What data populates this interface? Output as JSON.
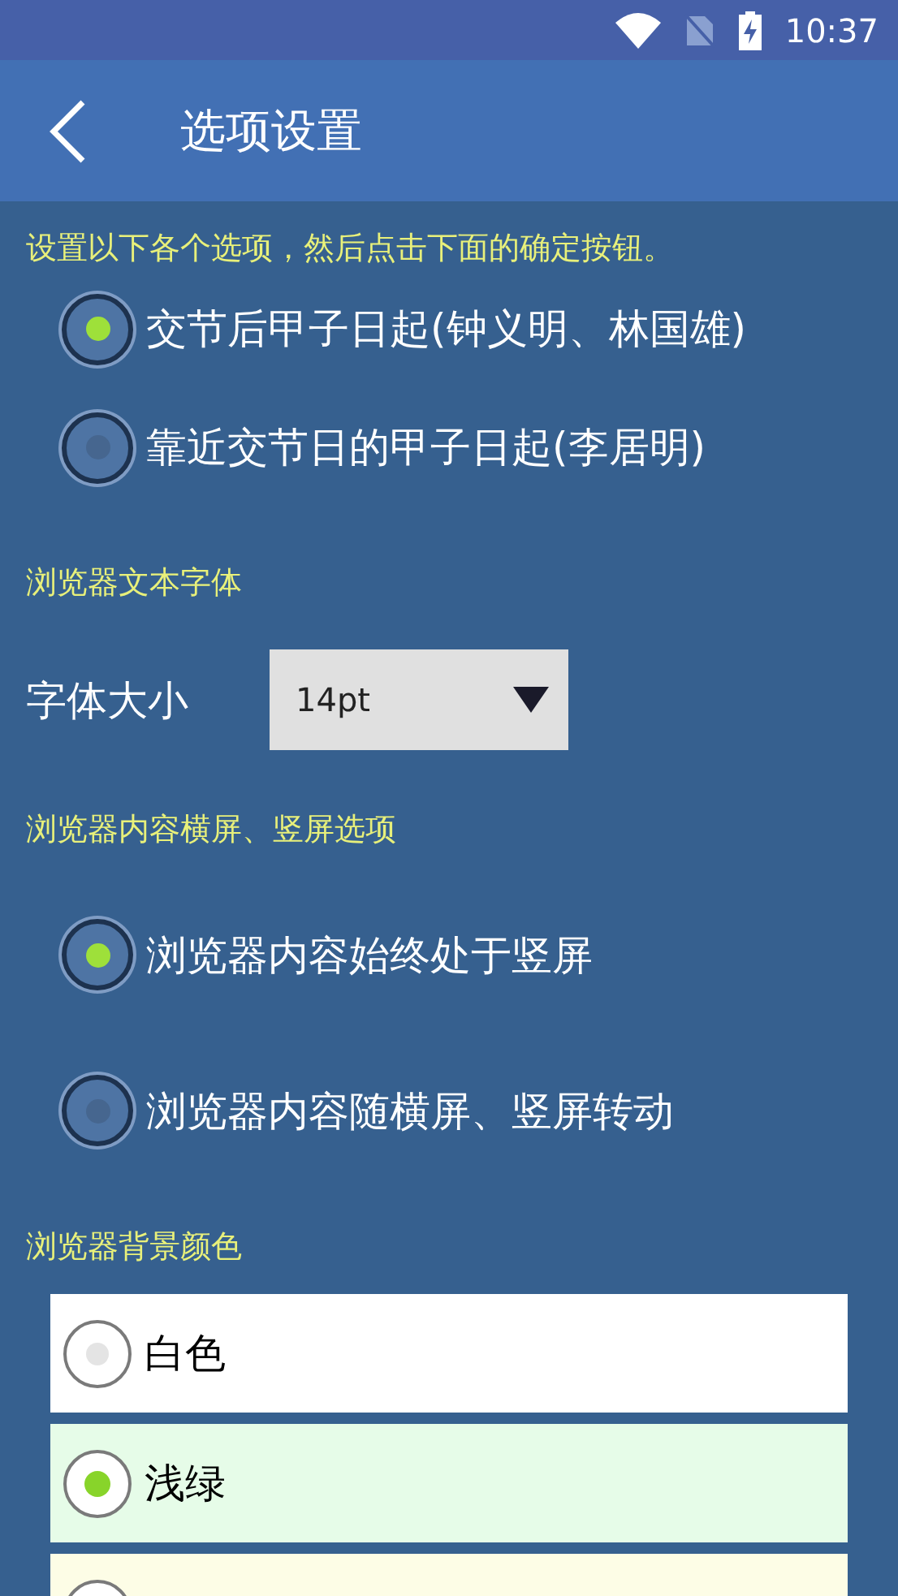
{
  "status_bar": {
    "time": "10:37"
  },
  "header": {
    "title": "选项设置"
  },
  "sections": [
    {
      "kind": "radio_group",
      "heading": "设置以下各个选项，然后点击下面的确定按钮。",
      "options": [
        {
          "label": "交节后甲子日起(钟义明、林国雄)",
          "selected": true
        },
        {
          "label": "靠近交节日的甲子日起(李居明)",
          "selected": false
        }
      ]
    },
    {
      "kind": "select",
      "heading": "浏览器文本字体",
      "label": "字体大小",
      "value": "14pt"
    },
    {
      "kind": "radio_group",
      "heading": "浏览器内容横屏、竖屏选项",
      "options": [
        {
          "label": "浏览器内容始终处于竖屏",
          "selected": true
        },
        {
          "label": "浏览器内容随横屏、竖屏转动",
          "selected": false
        }
      ]
    },
    {
      "kind": "color_list",
      "heading": "浏览器背景颜色",
      "options": [
        {
          "label": "白色",
          "color": "#ffffff",
          "selected": false
        },
        {
          "label": "浅绿",
          "color": "#e6fce8",
          "selected": true
        },
        {
          "color": "#fdfde6"
        }
      ]
    }
  ]
}
